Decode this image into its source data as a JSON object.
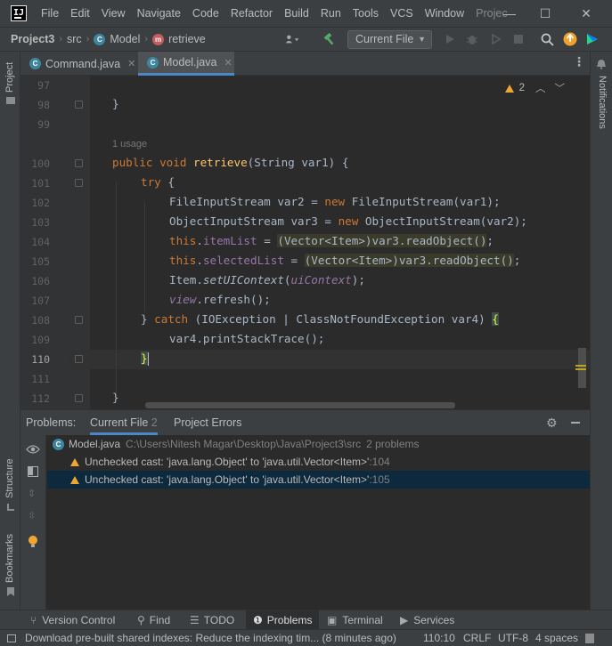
{
  "window": {
    "logo": "IJ",
    "menu": [
      "File",
      "Edit",
      "View",
      "Navigate",
      "Code",
      "Refactor",
      "Build",
      "Run",
      "Tools",
      "VCS",
      "Window",
      "Projec"
    ],
    "controls": {
      "minimize": "—",
      "maximize": "☐",
      "close": "✕"
    }
  },
  "nav": {
    "crumbs": [
      "Project3",
      "src",
      "Model",
      "retrieve"
    ],
    "run_config": "Current File"
  },
  "tabs": [
    {
      "label": "Command.java",
      "close": "✕"
    },
    {
      "label": "Model.java",
      "close": "✕"
    }
  ],
  "side": {
    "project": "Project",
    "notifications": "Notifications",
    "structure": "Structure",
    "bookmarks": "Bookmarks"
  },
  "editor": {
    "inspection_count": "2",
    "usage_hint": "1 usage",
    "line_numbers": [
      "97",
      "98",
      "99",
      "100",
      "101",
      "102",
      "103",
      "104",
      "105",
      "106",
      "107",
      "108",
      "109",
      "110",
      "111",
      "112"
    ],
    "code": {
      "l98": "}",
      "l100_kw": "public void ",
      "l100_fn": "retrieve",
      "l100_rest": "(String var1) {",
      "l101_kw": "try",
      "l101_rest": " {",
      "l102_a": "FileInputStream var2 = ",
      "l102_kw": "new",
      "l102_b": " FileInputStream(var1);",
      "l103_a": "ObjectInputStream var3 = ",
      "l103_kw": "new",
      "l103_b": " ObjectInputStream(var2);",
      "l104_kw": "this",
      "l104_dot": ".",
      "l104_fld": "itemList",
      "l104_eq": " = ",
      "l104_hl": "(Vector<Item>)var3.readObject()",
      "l104_end": ";",
      "l105_kw": "this",
      "l105_dot": ".",
      "l105_fld": "selectedList",
      "l105_eq": " = ",
      "l105_hl": "(Vector<Item>)var3.readObject()",
      "l105_end": ";",
      "l106_a": "Item.",
      "l106_it": "setUIContext",
      "l106_p": "(",
      "l106_fld": "uiContext",
      "l106_e": ");",
      "l107_fld": "view",
      "l107_rest": ".refresh();",
      "l108_a": "} ",
      "l108_kw": "catch",
      "l108_b": " (IOException | ClassNotFoundException var4) ",
      "l108_brace": "{",
      "l109": "var4.printStackTrace();",
      "l110": "}",
      "l112": "}"
    }
  },
  "problems": {
    "title": "Problems:",
    "tabs": [
      {
        "label": "Current File",
        "count": "2"
      },
      {
        "label": "Project Errors",
        "count": ""
      }
    ],
    "file": {
      "name": "Model.java",
      "path": "C:\\Users\\Nitesh Magar\\Desktop\\Java\\Project3\\src",
      "count": "2 problems"
    },
    "items": [
      {
        "text": "Unchecked cast: 'java.lang.Object' to 'java.util.Vector<Item>'",
        "line": ":104"
      },
      {
        "text": "Unchecked cast: 'java.lang.Object' to 'java.util.Vector<Item>'",
        "line": ":105"
      }
    ]
  },
  "tool_windows": [
    "Version Control",
    "Find",
    "TODO",
    "Problems",
    "Terminal",
    "Services"
  ],
  "status": {
    "message": "Download pre-built shared indexes: Reduce the indexing tim... (8 minutes ago)",
    "position": "110:10",
    "line_sep": "CRLF",
    "encoding": "UTF-8",
    "indent": "4 spaces"
  },
  "colors": {
    "accent": "#4a88c7",
    "warning": "#f0a732",
    "keyword": "#cc7832",
    "function": "#ffc66d",
    "field": "#9876aa"
  }
}
